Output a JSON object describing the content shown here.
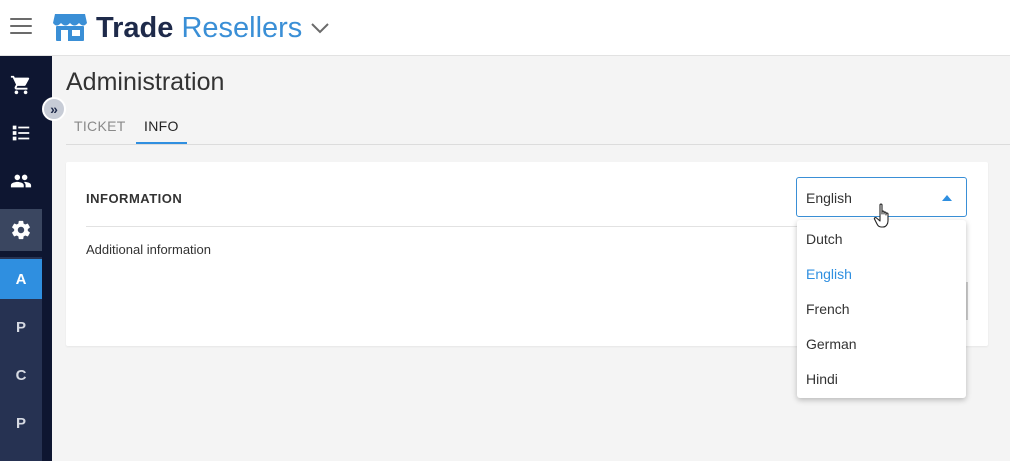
{
  "app": {
    "brand_part1": "Trade",
    "brand_part2": "Resellers",
    "accent": "#2f8fe0",
    "nav_bg": "#0e1631"
  },
  "rail": {
    "icons": [
      "cart-icon",
      "list-icon",
      "people-icon",
      "settings-icon"
    ],
    "letters": [
      "A",
      "P",
      "C",
      "P"
    ]
  },
  "page": {
    "title": "Administration"
  },
  "tabs": [
    {
      "label": "TICKET"
    },
    {
      "label": "INFO"
    }
  ],
  "card": {
    "heading": "INFORMATION",
    "text": "Additional information"
  },
  "language_select": {
    "value": "English",
    "options": [
      "Dutch",
      "English",
      "French",
      "German",
      "Hindi"
    ]
  }
}
